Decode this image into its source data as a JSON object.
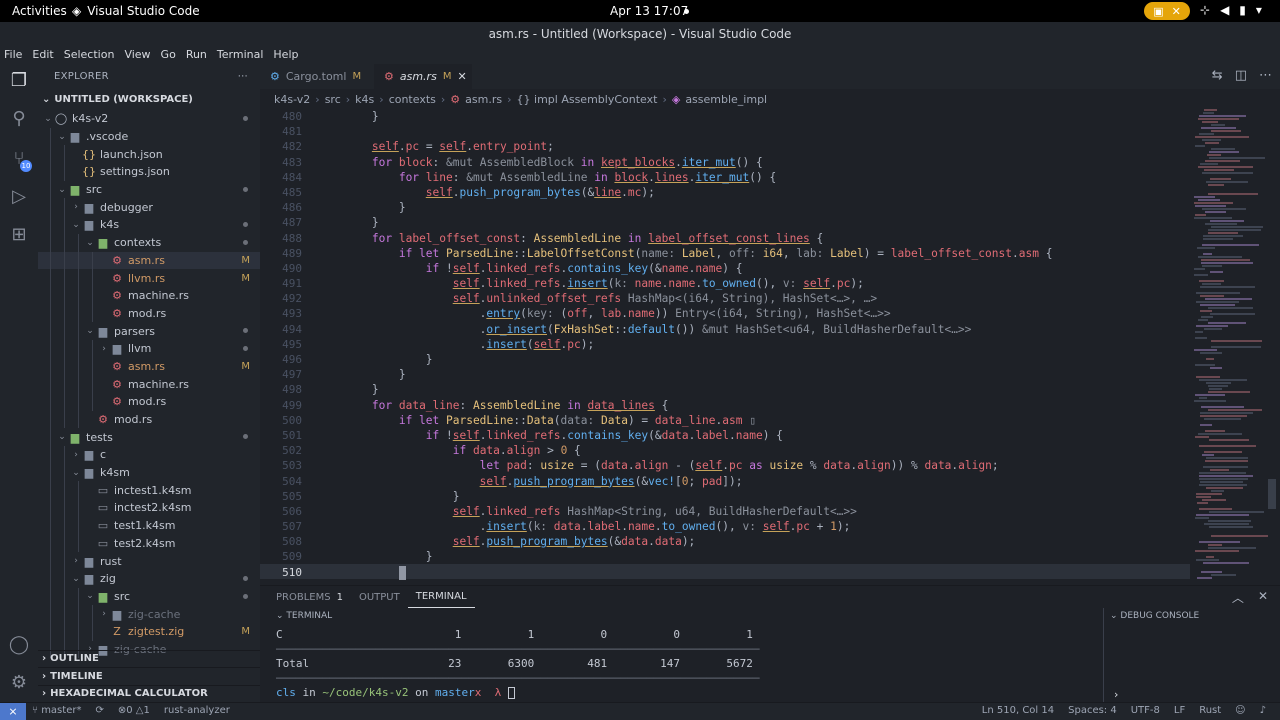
{
  "os": {
    "activities": "Activities",
    "app_name": "Visual Studio Code",
    "clock": "Apr 13  17:07"
  },
  "window": {
    "title": "asm.rs - Untitled (Workspace) - Visual Studio Code"
  },
  "menu": [
    "File",
    "Edit",
    "Selection",
    "View",
    "Go",
    "Run",
    "Terminal",
    "Help"
  ],
  "activity_bar": {
    "scm_badge": "10"
  },
  "sidebar": {
    "title": "EXPLORER",
    "workspace": "UNTITLED (WORKSPACE)",
    "tree": [
      {
        "label": "k4s-v2",
        "depth": 0,
        "kind": "root",
        "open": true,
        "status": "dot"
      },
      {
        "label": ".vscode",
        "depth": 1,
        "kind": "folder",
        "open": true,
        "status": ""
      },
      {
        "label": "launch.json",
        "depth": 2,
        "kind": "json",
        "status": ""
      },
      {
        "label": "settings.json",
        "depth": 2,
        "kind": "json",
        "status": ""
      },
      {
        "label": "src",
        "depth": 1,
        "kind": "folder-green",
        "open": true,
        "status": "dot"
      },
      {
        "label": "debugger",
        "depth": 2,
        "kind": "folder",
        "open": false,
        "status": ""
      },
      {
        "label": "k4s",
        "depth": 2,
        "kind": "folder",
        "open": true,
        "status": "dot"
      },
      {
        "label": "contexts",
        "depth": 3,
        "kind": "folder-green",
        "open": true,
        "status": "dot"
      },
      {
        "label": "asm.rs",
        "depth": 4,
        "kind": "rust",
        "status": "M",
        "selected": true
      },
      {
        "label": "llvm.rs",
        "depth": 4,
        "kind": "rust",
        "status": "M"
      },
      {
        "label": "machine.rs",
        "depth": 4,
        "kind": "rust",
        "status": ""
      },
      {
        "label": "mod.rs",
        "depth": 4,
        "kind": "rust",
        "status": ""
      },
      {
        "label": "parsers",
        "depth": 3,
        "kind": "folder",
        "open": true,
        "status": "dot"
      },
      {
        "label": "llvm",
        "depth": 4,
        "kind": "folder",
        "open": false,
        "status": "dot"
      },
      {
        "label": "asm.rs",
        "depth": 4,
        "kind": "rust",
        "status": "M"
      },
      {
        "label": "machine.rs",
        "depth": 4,
        "kind": "rust",
        "status": ""
      },
      {
        "label": "mod.rs",
        "depth": 4,
        "kind": "rust",
        "status": ""
      },
      {
        "label": "mod.rs",
        "depth": 3,
        "kind": "rust",
        "status": ""
      },
      {
        "label": "tests",
        "depth": 1,
        "kind": "folder-green",
        "open": true,
        "status": "dot"
      },
      {
        "label": "c",
        "depth": 2,
        "kind": "folder",
        "open": false,
        "status": ""
      },
      {
        "label": "k4sm",
        "depth": 2,
        "kind": "folder",
        "open": true,
        "status": ""
      },
      {
        "label": "inctest1.k4sm",
        "depth": 3,
        "kind": "file",
        "status": ""
      },
      {
        "label": "inctest2.k4sm",
        "depth": 3,
        "kind": "file",
        "status": ""
      },
      {
        "label": "test1.k4sm",
        "depth": 3,
        "kind": "file",
        "status": ""
      },
      {
        "label": "test2.k4sm",
        "depth": 3,
        "kind": "file",
        "status": ""
      },
      {
        "label": "rust",
        "depth": 2,
        "kind": "folder",
        "open": false,
        "status": ""
      },
      {
        "label": "zig",
        "depth": 2,
        "kind": "folder",
        "open": true,
        "status": "dot"
      },
      {
        "label": "src",
        "depth": 3,
        "kind": "folder-green",
        "open": true,
        "status": "dot"
      },
      {
        "label": "zig-cache",
        "depth": 4,
        "kind": "folder",
        "open": false,
        "status": "",
        "dim": true
      },
      {
        "label": "zigtest.zig",
        "depth": 4,
        "kind": "zig",
        "status": "M"
      },
      {
        "label": "zig-cache",
        "depth": 3,
        "kind": "folder",
        "open": false,
        "status": "",
        "dim": true
      }
    ],
    "bottom_sections": [
      "OUTLINE",
      "TIMELINE",
      "HEXADECIMAL CALCULATOR"
    ]
  },
  "tabs": [
    {
      "label": "Cargo.toml",
      "status": "M",
      "icon": "gear-icon",
      "active": false
    },
    {
      "label": "asm.rs",
      "status": "M",
      "icon": "rust-icon",
      "active": true
    }
  ],
  "breadcrumb": [
    "k4s-v2",
    "src",
    "k4s",
    "contexts",
    "asm.rs",
    "{} impl AssemblyContext",
    "assemble_impl"
  ],
  "editor": {
    "line_numbers": [
      "480",
      "481",
      "482",
      "483",
      "484",
      "485",
      "486",
      "487",
      "488",
      "489",
      "490",
      "491",
      "492",
      "493",
      "494",
      "495",
      "496",
      "497",
      "498",
      "499",
      "500",
      "501",
      "502",
      "503",
      "504",
      "505",
      "506",
      "507",
      "508",
      "509",
      "510"
    ],
    "current_line": "510"
  },
  "panel": {
    "tabs": [
      {
        "label": "PROBLEMS",
        "count": "1"
      },
      {
        "label": "OUTPUT",
        "count": ""
      },
      {
        "label": "TERMINAL",
        "count": "",
        "active": true
      }
    ],
    "terminal_title": "TERMINAL",
    "debug_title": "DEBUG CONSOLE",
    "debug_prompt": "›",
    "terminal_lines": [
      "C                          1          1          0          0          1",
      "─────────────────────────────────────────────────────────────────────────",
      "Total                     23       6300        481        147       5672",
      "─────────────────────────────────────────────────────────────────────────"
    ],
    "prompt": {
      "user": "cls",
      "in": " in ",
      "path": "~/code/k4s-v2",
      "on": " on ",
      "branch": "master",
      "mark": "x",
      "lambda": "λ"
    }
  },
  "statusbar": {
    "branch": "master*",
    "errors": "0",
    "warnings": "1",
    "lsp": "rust-analyzer",
    "position": "Ln 510, Col 14",
    "spaces": "Spaces: 4",
    "encoding": "UTF-8",
    "eol": "LF",
    "language": "Rust"
  }
}
